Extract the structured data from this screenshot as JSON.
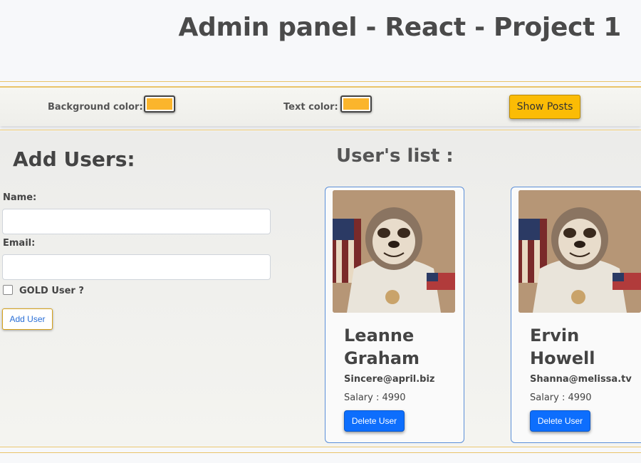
{
  "header": {
    "title": "Admin panel - React - Project 1"
  },
  "toolbar": {
    "bg_label": "Background color:",
    "text_label": "Text color:",
    "bg_color": "#fbb52c",
    "text_color": "#fbb52c",
    "posts_button": "Show Posts"
  },
  "form": {
    "title": "Add Users:",
    "name_label": "Name:",
    "name_value": "",
    "email_label": "Email:",
    "email_value": "",
    "gold_label": "GOLD User ?",
    "gold_checked": false,
    "submit_label": "Add User"
  },
  "users": {
    "title": "User's list :",
    "items": [
      {
        "name": "Leanne Graham",
        "email": "Sincere@april.biz",
        "salary": "Salary : 4990",
        "delete_label": "Delete User",
        "avatar": "sloth-astronaut-image"
      },
      {
        "name": "Ervin Howell",
        "email": "Shanna@melissa.tv",
        "salary": "Salary : 4990",
        "delete_label": "Delete User",
        "avatar": "sloth-astronaut-image"
      }
    ]
  },
  "colors": {
    "accent": "#fbbc05",
    "primary": "#0d6efd",
    "rule": "#e9c46a"
  }
}
